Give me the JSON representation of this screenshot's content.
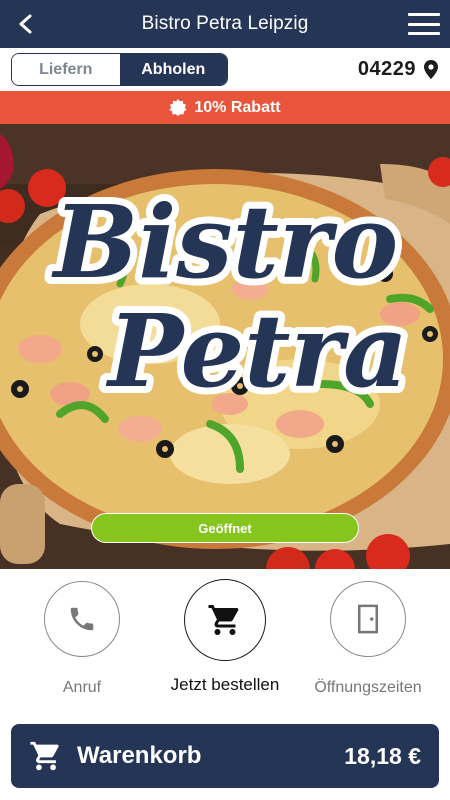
{
  "header": {
    "title": "Bistro Petra Leipzig",
    "back_icon": "chevron-left-icon",
    "menu_icon": "hamburger-menu-icon"
  },
  "mode_toggle": {
    "options": [
      {
        "label": "Liefern",
        "selected": false
      },
      {
        "label": "Abholen",
        "selected": true
      }
    ]
  },
  "location": {
    "zip": "04229",
    "icon": "location-pin-icon"
  },
  "promo": {
    "label": "10% Rabatt",
    "icon": "badge-icon",
    "color": "#e8553a"
  },
  "hero": {
    "logo_text_line1": "Bistro",
    "logo_text_line2": "Petra",
    "status_label": "Geöffnet",
    "status_color": "#85c51d"
  },
  "actions": [
    {
      "label": "Anruf",
      "icon": "phone-icon"
    },
    {
      "label": "Jetzt bestellen",
      "icon": "cart-icon"
    },
    {
      "label": "Öffnungszeiten",
      "icon": "door-icon"
    }
  ],
  "cart": {
    "label": "Warenkorb",
    "total": "18,18 €",
    "icon": "cart-icon"
  },
  "colors": {
    "primary": "#243556",
    "accent": "#e8553a",
    "open": "#85c51d"
  }
}
